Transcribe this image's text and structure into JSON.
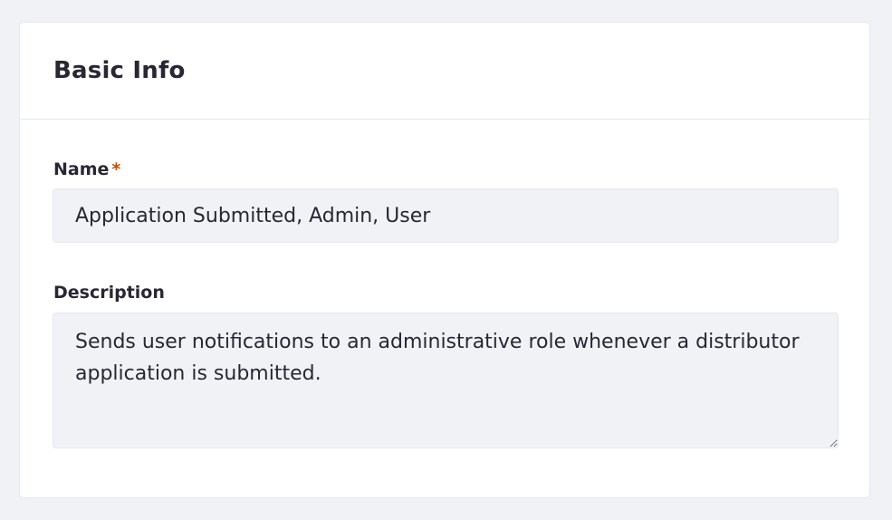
{
  "card": {
    "title": "Basic Info"
  },
  "fields": {
    "name": {
      "label": "Name",
      "required_mark": "*",
      "value": "Application Submitted, Admin, User"
    },
    "description": {
      "label": "Description",
      "value": "Sends user notifications to an administrative role whenever a distributor application is submitted."
    }
  },
  "colors": {
    "page_background": "#f1f2f5",
    "card_background": "#ffffff",
    "input_background": "#f1f2f5",
    "text": "#272833",
    "required_mark": "#b95000"
  }
}
